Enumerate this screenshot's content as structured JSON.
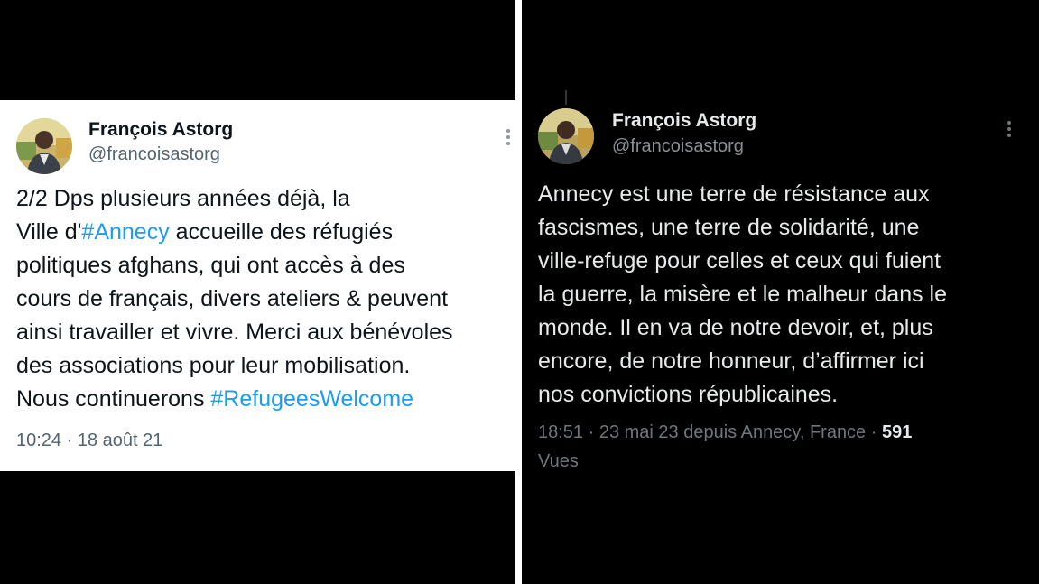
{
  "left_tweet": {
    "author_name": "François Astorg",
    "author_handle": "@francoisastorg",
    "body_lines": [
      [
        "2/2 Dps plusieurs années déjà, la"
      ],
      [
        "Ville d'",
        "#Annecy",
        " accueille des réfugiés"
      ],
      [
        "politiques afghans, qui ont accès à des"
      ],
      [
        "cours de français, divers ateliers & peuvent"
      ],
      [
        "ainsi travailler et vivre. Merci aux bénévoles"
      ],
      [
        "des associations pour leur mobilisation."
      ],
      [
        "Nous continuerons ",
        "#RefugeesWelcome"
      ]
    ],
    "timestamp": "10:24 · 18 août 21"
  },
  "right_tweet": {
    "author_name": "François Astorg",
    "author_handle": "@francoisastorg",
    "body_lines": [
      "Annecy est une terre de résistance aux",
      "fascismes, une terre de solidarité, une",
      "ville-refuge pour celles et ceux qui fuient",
      "la guerre, la misère et le malheur dans le",
      "monde. Il en va de notre devoir, et, plus",
      "encore, de notre honneur, d’affirmer ici",
      "nos convictions républicaines."
    ],
    "meta_prefix": "18:51 · 23 mai 23 depuis Annecy, France · ",
    "views_count": "591",
    "views_label": "Vues"
  },
  "icons": {
    "more": "more-vertical-icon",
    "avatar": "profile-photo"
  },
  "colors": {
    "hashtag": "#1d9bf0",
    "dark_bg": "#000000",
    "light_bg": "#ffffff",
    "dark_text": "#e7e9ea",
    "muted": "#71767b"
  }
}
